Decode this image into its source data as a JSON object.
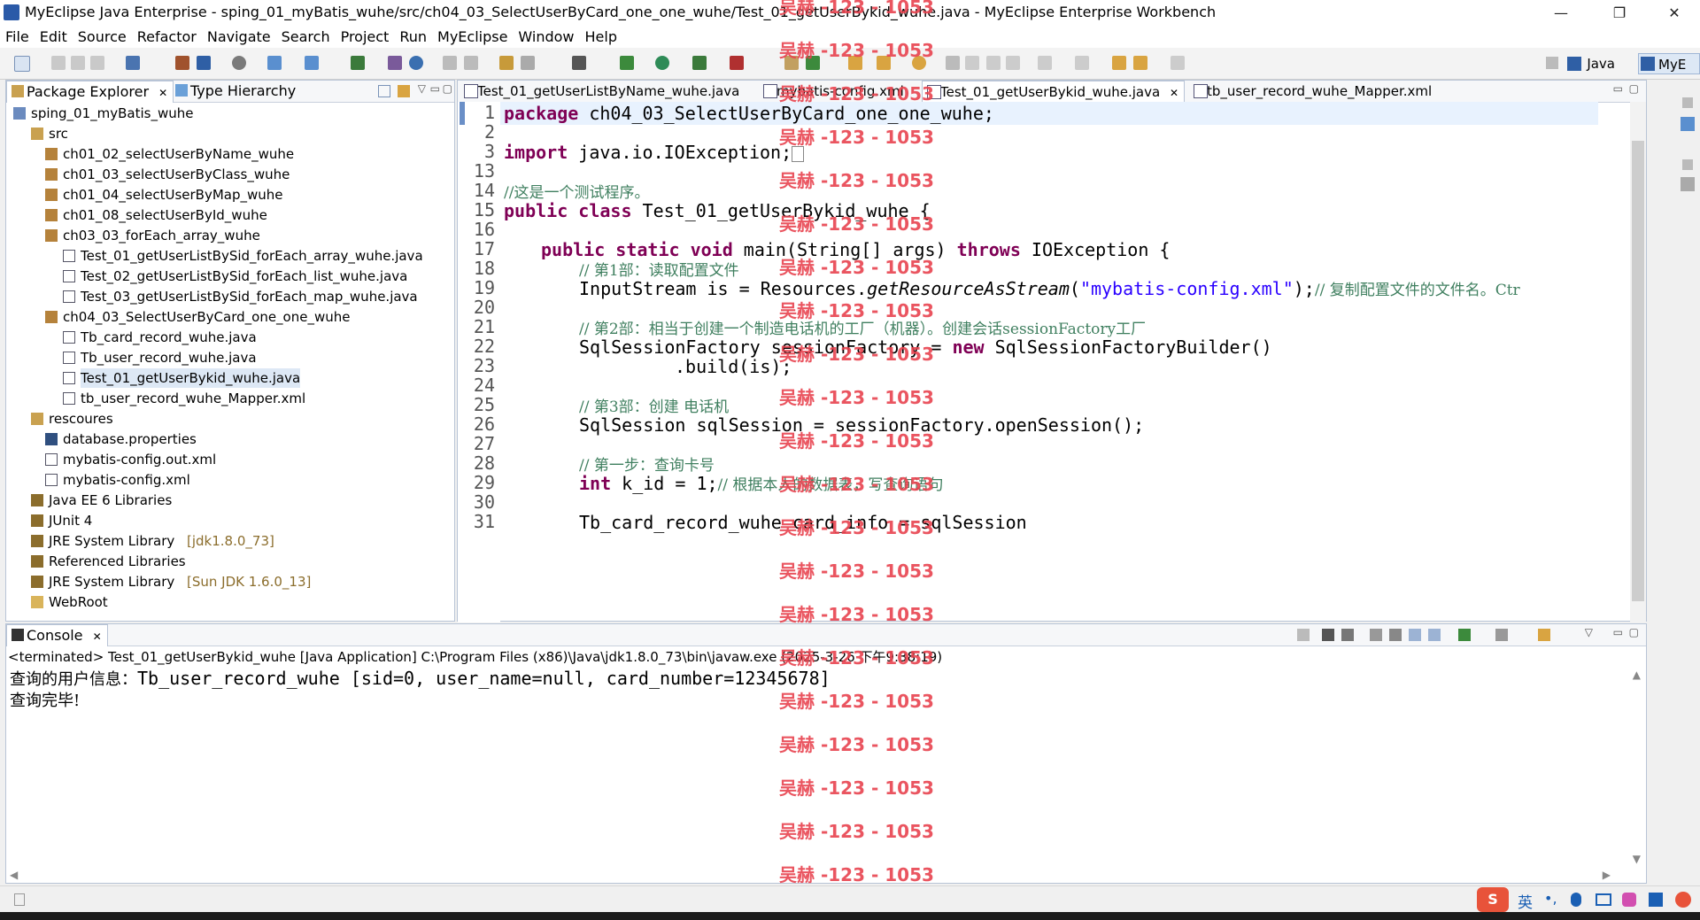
{
  "window": {
    "title": "MyEclipse Java Enterprise - sping_01_myBatis_wuhe/src/ch04_03_SelectUserByCard_one_one_wuhe/Test_01_getUserBykid_wuhe.java - MyEclipse Enterprise Workbench",
    "minimize": "—",
    "restore": "❐",
    "close": "✕"
  },
  "menu": [
    "File",
    "Edit",
    "Source",
    "Refactor",
    "Navigate",
    "Search",
    "Project",
    "Run",
    "MyEclipse",
    "Window",
    "Help"
  ],
  "perspectives": {
    "java": "Java",
    "myeclipse": "MyE"
  },
  "left_panel": {
    "tabs": [
      "Package Explorer",
      "Type Hierarchy"
    ],
    "tree": [
      {
        "label": "sping_01_myBatis_wuhe",
        "icon": "project-icon"
      },
      {
        "label": "src",
        "icon": "source-folder-icon"
      },
      {
        "label": "ch01_02_selectUserByName_wuhe",
        "icon": "package-icon"
      },
      {
        "label": "ch01_03_selectUserByClass_wuhe",
        "icon": "package-icon"
      },
      {
        "label": "ch01_04_selectUserByMap_wuhe",
        "icon": "package-icon"
      },
      {
        "label": "ch01_08_selectUserById_wuhe",
        "icon": "package-icon"
      },
      {
        "label": "ch03_03_forEach_array_wuhe",
        "icon": "package-icon"
      },
      {
        "label": "Test_01_getUserListBySid_forEach_array_wuhe.java",
        "icon": "java-file-icon"
      },
      {
        "label": "Test_02_getUserListBySid_forEach_list_wuhe.java",
        "icon": "java-file-icon"
      },
      {
        "label": "Test_03_getUserListBySid_forEach_map_wuhe.java",
        "icon": "java-file-icon"
      },
      {
        "label": "ch04_03_SelectUserByCard_one_one_wuhe",
        "icon": "package-icon"
      },
      {
        "label": "Tb_card_record_wuhe.java",
        "icon": "java-file-icon"
      },
      {
        "label": "Tb_user_record_wuhe.java",
        "icon": "java-file-icon"
      },
      {
        "label": "Test_01_getUserBykid_wuhe.java",
        "icon": "java-file-icon"
      },
      {
        "label": "tb_user_record_wuhe_Mapper.xml",
        "icon": "xml-file-icon"
      },
      {
        "label": "rescoures",
        "icon": "source-folder-icon"
      },
      {
        "label": "database.properties",
        "icon": "properties-file-icon"
      },
      {
        "label": "mybatis-config.out.xml",
        "icon": "xml-file-icon"
      },
      {
        "label": "mybatis-config.xml",
        "icon": "xml-file-icon"
      },
      {
        "label": "Java EE 6 Libraries",
        "icon": "library-icon"
      },
      {
        "label": "JUnit 4",
        "icon": "library-icon"
      },
      {
        "label": "JRE System Library",
        "icon": "library-icon",
        "decoration": "[jdk1.8.0_73]"
      },
      {
        "label": "Referenced Libraries",
        "icon": "library-icon"
      },
      {
        "label": "JRE System Library",
        "icon": "library-icon",
        "decoration": "[Sun JDK 1.6.0_13]"
      },
      {
        "label": "WebRoot",
        "icon": "folder-icon"
      }
    ]
  },
  "editor": {
    "tabs": [
      "Test_01_getUserListByName_wuhe.java",
      "mybatis-config.xml",
      "Test_01_getUserBykid_wuhe.java",
      "tb_user_record_wuhe_Mapper.xml"
    ],
    "active_tab": 2,
    "line_numbers": [
      "1",
      "2",
      "3",
      "13",
      "14",
      "15",
      "16",
      "17",
      "18",
      "19",
      "20",
      "21",
      "22",
      "23",
      "24",
      "25",
      "26",
      "27",
      "28",
      "29",
      "30",
      "31"
    ],
    "lines": {
      "l1_kw": "package",
      "l1_rest": " ch04_03_SelectUserByCard_one_one_wuhe;",
      "l3_kw": "import",
      "l3_rest": " java.io.IOException;",
      "l14_cm": "//这是一个测试程序。",
      "l15_kw": "public class",
      "l15_rest": " Test_01_getUserBykid_wuhe {",
      "l17_kw1": "public static void",
      "l17_mid": " main(String[] args) ",
      "l17_kw2": "throws",
      "l17_rest": " IOException {",
      "l18_cm": "// 第1部：读取配置文件",
      "l19_a": "InputStream is = Resources.",
      "l19_it": "getResourceAsStream",
      "l19_b": "(",
      "l19_str": "\"mybatis-config.xml\"",
      "l19_c": ");",
      "l19_cm": "// 复制配置文件的文件名。Ctr",
      "l21_cm": "// 第2部：相当于创建一个制造电话机的工厂（机器）。创建会话sessionFactory工厂",
      "l22_a": "SqlSessionFactory sessionFactory = ",
      "l22_kw": "new",
      "l22_b": " SqlSessionFactoryBuilder()",
      "l23": ".build(is);",
      "l25_cm": "// 第3部：创建 电话机",
      "l26": "SqlSession sqlSession = sessionFactory.openSession();",
      "l28_cm": "// 第一步：查询卡号",
      "l29_kw": "int",
      "l29_rest": " k_id = 1;",
      "l29_cm": "// 根据本人的数据表，写查询语句",
      "l31": "Tb_card_record_wuhe card_info = sqlSession"
    }
  },
  "console": {
    "tab": "Console",
    "terminated": "<terminated> Test_01_getUserBykid_wuhe [Java Application] C:\\Program Files (x86)\\Java\\jdk1.8.0_73\\bin\\javaw.exe (2025-3-26 下午9:38:19)",
    "out1_cjk": "查询的用户信息：",
    "out1": "Tb_user_record_wuhe [sid=0, user_name=null, card_number=12345678]",
    "out2": "查询完毕!"
  },
  "watermark": "吴赫 -123 - 1053",
  "ime": {
    "lang": "英",
    "punct": "•,"
  },
  "colors": {
    "keyword": "#7f0055",
    "comment": "#3f7f5f",
    "string": "#2a00ff",
    "watermark": "#e8434f"
  }
}
